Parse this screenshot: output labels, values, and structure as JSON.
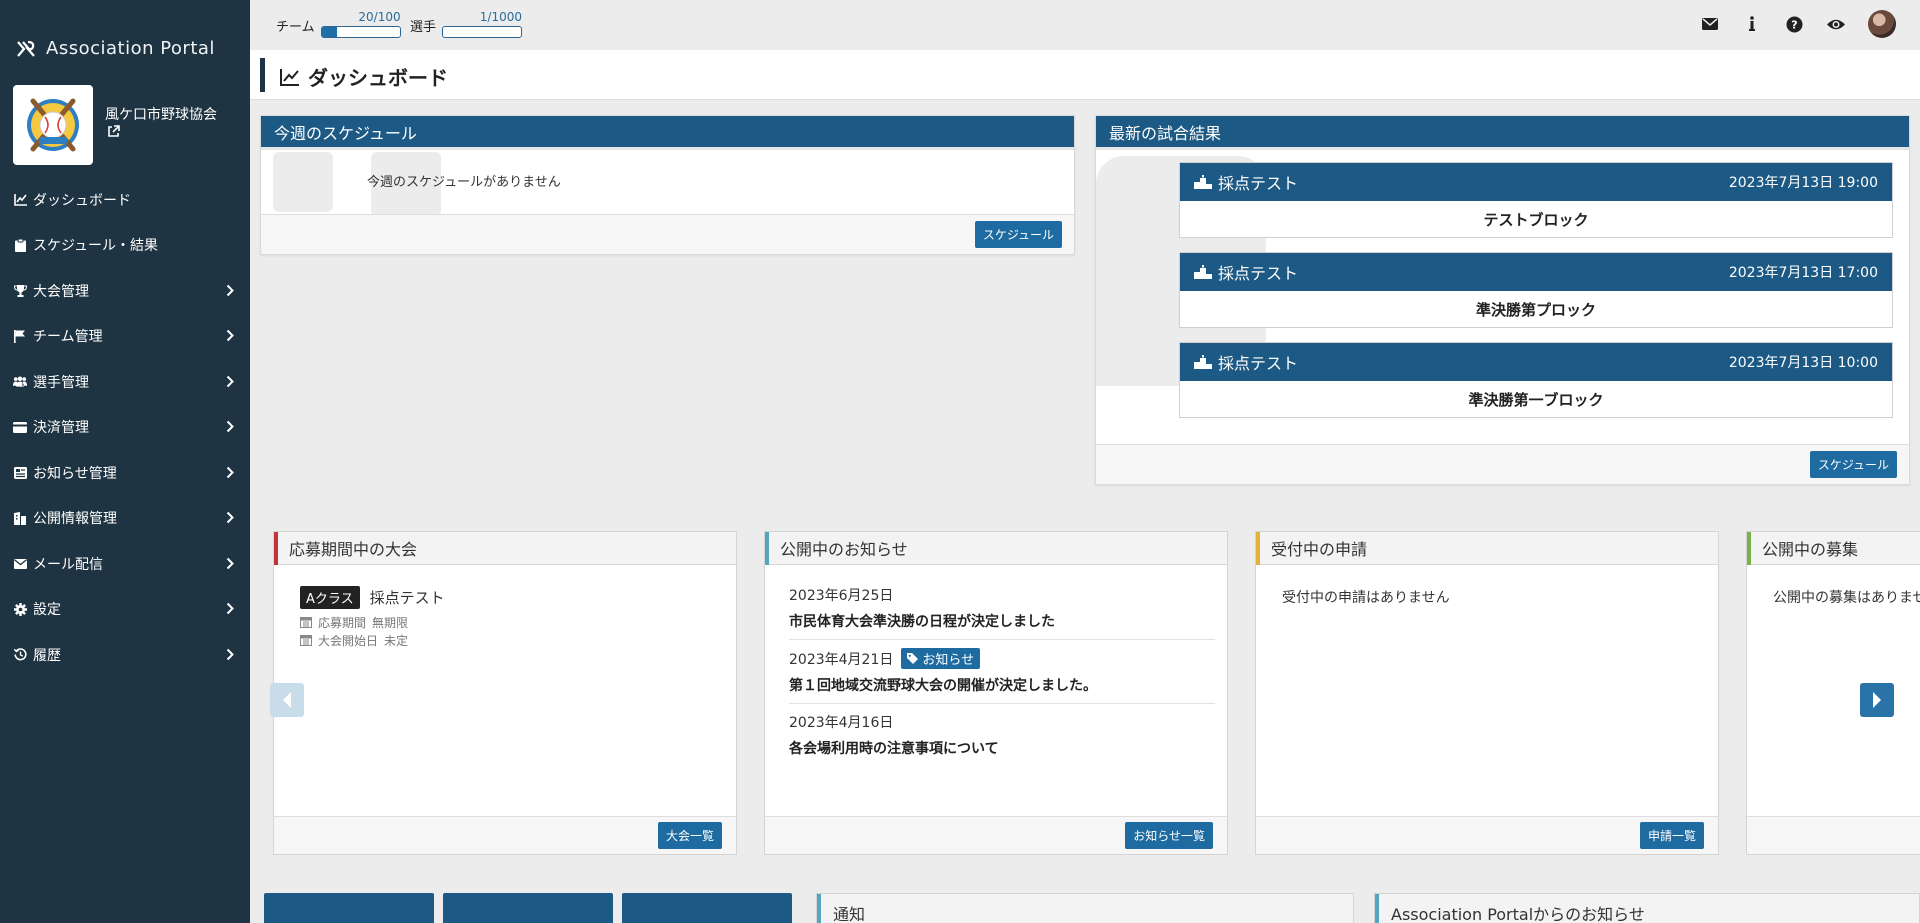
{
  "app": {
    "brand": "Association Portal",
    "org_name": "風ケ口市野球協会"
  },
  "topbar": {
    "team_label": "チーム",
    "team_value": "20/100",
    "team_progress": 0.2,
    "player_label": "選手",
    "player_value": "1/1000",
    "player_progress": 0.001
  },
  "sidebar": {
    "items": [
      {
        "label": "ダッシュボード",
        "icon": "chart-line-icon",
        "expandable": false
      },
      {
        "label": "スケジュール・結果",
        "icon": "clipboard-icon",
        "expandable": false
      },
      {
        "label": "大会管理",
        "icon": "trophy-icon",
        "expandable": true
      },
      {
        "label": "チーム管理",
        "icon": "flag-icon",
        "expandable": true
      },
      {
        "label": "選手管理",
        "icon": "users-icon",
        "expandable": true
      },
      {
        "label": "決済管理",
        "icon": "credit-card-icon",
        "expandable": true
      },
      {
        "label": "お知らせ管理",
        "icon": "newspaper-icon",
        "expandable": true
      },
      {
        "label": "公開情報管理",
        "icon": "building-icon",
        "expandable": true
      },
      {
        "label": "メール配信",
        "icon": "envelope-icon",
        "expandable": true
      },
      {
        "label": "設定",
        "icon": "gear-icon",
        "expandable": true
      },
      {
        "label": "履歴",
        "icon": "history-icon",
        "expandable": true
      }
    ]
  },
  "page": {
    "title": "ダッシュボード"
  },
  "schedule": {
    "title": "今週のスケジュール",
    "empty": "今週のスケジュールがありません",
    "button": "スケジュール"
  },
  "results": {
    "title": "最新の試合結果",
    "button": "スケジュール",
    "items": [
      {
        "name": "採点テスト",
        "date": "2023年7月13日 19:00",
        "block": "テストブロック"
      },
      {
        "name": "採点テスト",
        "date": "2023年7月13日 17:00",
        "block": "準決勝第プロック"
      },
      {
        "name": "採点テスト",
        "date": "2023年7月13日 10:00",
        "block": "準決勝第一ブロック"
      }
    ]
  },
  "tournaments": {
    "title": "応募期間中の大会",
    "class_tag": "Aクラス",
    "name": "採点テスト",
    "period_label": "応募期間",
    "period_value": "無期限",
    "start_label": "大会開始日",
    "start_value": "未定",
    "button": "大会一覧",
    "accent": "#c0343a"
  },
  "news": {
    "title": "公開中のお知らせ",
    "button": "お知らせ一覧",
    "accent": "#52a7bd",
    "items": [
      {
        "date": "2023年6月25日",
        "tag": "",
        "title": "市民体育大会準決勝の日程が決定しました"
      },
      {
        "date": "2023年4月21日",
        "tag": "お知らせ",
        "title": "第１回地域交流野球大会の開催が決定しました。"
      },
      {
        "date": "2023年4月16日",
        "tag": "",
        "title": "各会場利用時の注意事項について"
      }
    ]
  },
  "applications": {
    "title": "受付中の申請",
    "empty": "受付中の申請はありません",
    "button": "申請一覧",
    "accent": "#e2b23a"
  },
  "recruit": {
    "title": "公開中の募集",
    "empty": "公開中の募集はありません",
    "accent": "#7ab04a"
  },
  "bottom": {
    "notice_title": "通知",
    "portal_news_title": "Association Portalからのお知らせ"
  }
}
